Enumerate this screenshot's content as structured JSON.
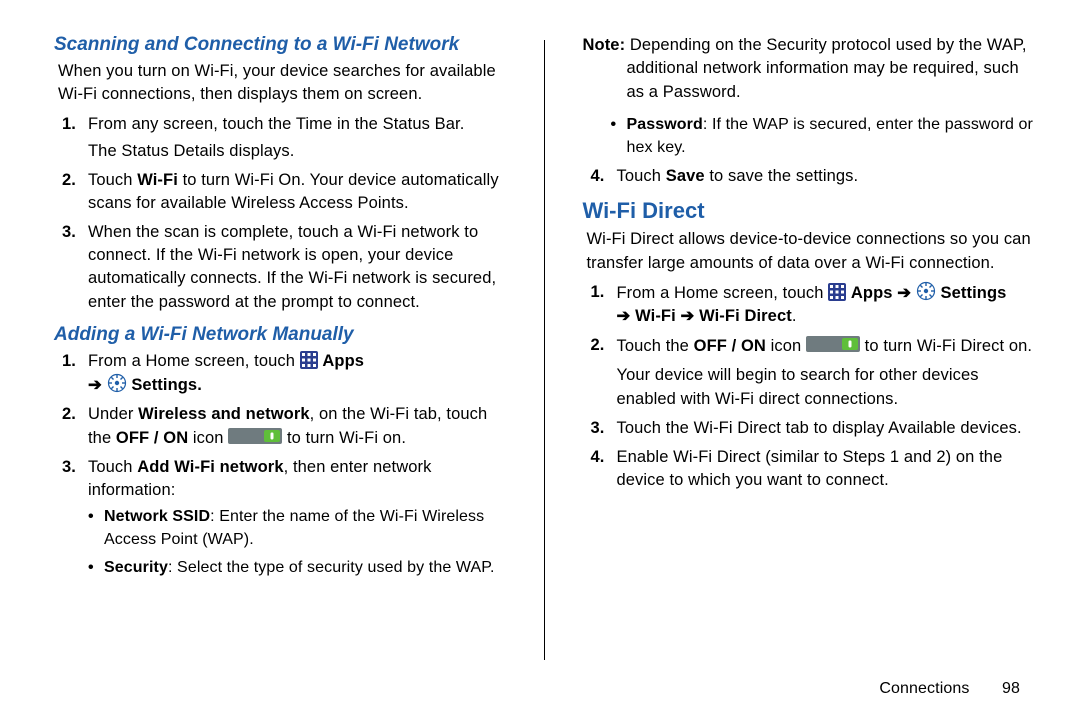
{
  "left": {
    "scanHeading": "Scanning and Connecting to a Wi-Fi Network",
    "scanIntro": "When you turn on Wi-Fi, your device searches for available Wi-Fi connections, then displays them on screen.",
    "scanSteps": {
      "s1a": "From any screen, touch the Time in the Status Bar.",
      "s1b": "The Status Details displays.",
      "s2a": "Touch ",
      "s2b": "Wi-Fi",
      "s2c": " to turn Wi-Fi On. Your device automatically scans for available Wireless Access Points.",
      "s3": "When the scan is complete, touch a Wi-Fi network to connect. If the Wi-Fi network is open, your device automatically connects. If the Wi-Fi network is secured, enter the password at the prompt to connect."
    },
    "addHeading": "Adding a Wi-Fi Network Manually",
    "addSteps": {
      "s1a": "From a Home screen, touch ",
      "s1apps": "Apps",
      "s1arrow": " ➔ ",
      "s1settings": "Settings.",
      "s2a": "Under ",
      "s2b": "Wireless and network",
      "s2c": ", on the Wi-Fi tab, touch the ",
      "s2d": "OFF / ON",
      "s2e": " icon ",
      "s2f": " to turn Wi-Fi on.",
      "s3a": "Touch ",
      "s3b": "Add Wi-Fi network",
      "s3c": ", then enter network information:",
      "bullets": {
        "b1a": "Network SSID",
        "b1b": ": Enter the name of the Wi-Fi Wireless Access Point (WAP).",
        "b2a": "Security",
        "b2b": ": Select the type of security used by the WAP."
      }
    }
  },
  "right": {
    "noteLabel": "Note:",
    "noteText": " Depending on the Security protocol used by the WAP, additional network information may be required, such as a Password.",
    "bullets": {
      "pw1": "Password",
      "pw2": ": If the WAP is secured, enter the password or hex key."
    },
    "s4a": "Touch ",
    "s4b": "Save",
    "s4c": " to save the settings.",
    "wfdHeading": "Wi-Fi Direct",
    "wfdIntro": "Wi-Fi Direct allows device-to-device connections so you can transfer large amounts of data over a Wi-Fi connection.",
    "wfd": {
      "s1a": "From a Home screen, touch ",
      "apps": "Apps",
      "arrow1": " ➔ ",
      "settings": "Settings",
      "arrow2": " ➔ ",
      "wifi": "Wi-Fi",
      "arrow3": " ➔ ",
      "wifidir": "Wi-Fi Direct",
      "period": ".",
      "s2a": "Touch the ",
      "s2b": "OFF / ON",
      "s2c": " icon ",
      "s2d": " to turn Wi-Fi Direct on.",
      "s2e": "Your device will begin to search for other devices enabled with Wi-Fi direct connections.",
      "s3": "Touch the Wi-Fi Direct tab to display Available devices.",
      "s4": "Enable Wi-Fi Direct (similar to Steps 1 and 2) on the device to which you want to connect."
    }
  },
  "footer": {
    "section": "Connections",
    "page": "98"
  }
}
